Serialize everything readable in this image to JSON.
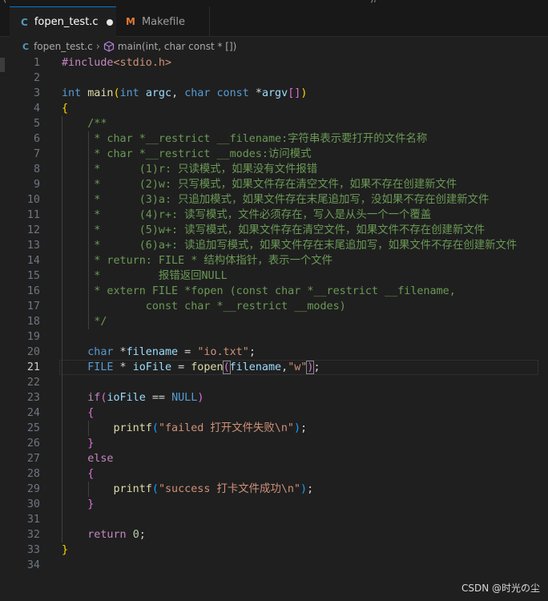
{
  "top_fragments": [
    "(",
    "), "
  ],
  "tabs": [
    {
      "icon": "C",
      "label": "fopen_test.c",
      "active": true,
      "modified": true
    },
    {
      "icon": "M",
      "label": "Makefile",
      "active": false
    }
  ],
  "breadcrumb": {
    "file_icon": "C",
    "file": "fopen_test.c",
    "symbol": "main(int, char const * [])"
  },
  "current_line": 21,
  "lines": [
    {
      "n": "1",
      "t": [
        [
          "pp",
          "#include"
        ],
        [
          "hdr",
          "<stdio.h>"
        ]
      ]
    },
    {
      "n": "2",
      "t": []
    },
    {
      "n": "3",
      "t": [
        [
          "kw",
          "int"
        ],
        [
          "op",
          " "
        ],
        [
          "fn",
          "main"
        ],
        [
          "br1",
          "("
        ],
        [
          "kw",
          "int"
        ],
        [
          "op",
          " "
        ],
        [
          "var",
          "argc"
        ],
        [
          "op",
          ", "
        ],
        [
          "kw",
          "char"
        ],
        [
          "op",
          " "
        ],
        [
          "kw",
          "const"
        ],
        [
          "op",
          " *"
        ],
        [
          "var",
          "argv"
        ],
        [
          "br2",
          "[]"
        ],
        [
          "br1",
          ")"
        ]
      ]
    },
    {
      "n": "4",
      "t": [
        [
          "br1",
          "{"
        ]
      ]
    },
    {
      "n": "5",
      "t": [
        [
          "cm",
          "    /**"
        ]
      ]
    },
    {
      "n": "6",
      "t": [
        [
          "cm",
          "     * char *__restrict __filename:字符串表示要打开的文件名称"
        ]
      ]
    },
    {
      "n": "7",
      "t": [
        [
          "cm",
          "     * char *__restrict __modes:访问模式"
        ]
      ]
    },
    {
      "n": "8",
      "t": [
        [
          "cm",
          "     *      (1)r: 只读模式，如果没有文件报错"
        ]
      ]
    },
    {
      "n": "9",
      "t": [
        [
          "cm",
          "     *      (2)w: 只写模式，如果文件存在清空文件，如果不存在创建新文件"
        ]
      ]
    },
    {
      "n": "10",
      "t": [
        [
          "cm",
          "     *      (3)a: 只追加模式，如果文件存在末尾追加写，没如果不存在创建新文件"
        ]
      ]
    },
    {
      "n": "11",
      "t": [
        [
          "cm",
          "     *      (4)r+: 读写模式，文件必须存在，写入是从头一个一个覆盖"
        ]
      ]
    },
    {
      "n": "12",
      "t": [
        [
          "cm",
          "     *      (5)w+: 读写模式，如果文件存在清空文件，如果文件不存在创建新文件"
        ]
      ]
    },
    {
      "n": "13",
      "t": [
        [
          "cm",
          "     *      (6)a+: 读追加写模式，如果文件存在末尾追加写，如果文件不存在创建新文件"
        ]
      ]
    },
    {
      "n": "14",
      "t": [
        [
          "cm",
          "     * return: FILE * 结构体指针，表示一个文件"
        ]
      ]
    },
    {
      "n": "15",
      "t": [
        [
          "cm",
          "     *         报错返回NULL"
        ]
      ]
    },
    {
      "n": "16",
      "t": [
        [
          "cm",
          "     * extern FILE *fopen (const char *__restrict __filename,"
        ]
      ]
    },
    {
      "n": "17",
      "t": [
        [
          "cm",
          "             const char *__restrict __modes)"
        ]
      ]
    },
    {
      "n": "18",
      "t": [
        [
          "cm",
          "     */"
        ]
      ]
    },
    {
      "n": "19",
      "t": []
    },
    {
      "n": "20",
      "t": [
        [
          "op",
          "    "
        ],
        [
          "kw",
          "char"
        ],
        [
          "op",
          " *"
        ],
        [
          "var",
          "filename"
        ],
        [
          "op",
          " = "
        ],
        [
          "str",
          "\"io.txt\""
        ],
        [
          "op",
          ";"
        ]
      ]
    },
    {
      "n": "21",
      "t": [
        [
          "op",
          "    "
        ],
        [
          "kw",
          "FILE"
        ],
        [
          "op",
          " * "
        ],
        [
          "var",
          "ioFile"
        ],
        [
          "op",
          " = "
        ],
        [
          "fn",
          "fopen"
        ],
        [
          "br2",
          "("
        ],
        [
          "var",
          "filename"
        ],
        [
          "op",
          ","
        ],
        [
          "str",
          "\"w\""
        ],
        [
          "br2",
          ")"
        ],
        [
          "op",
          ";"
        ]
      ]
    },
    {
      "n": "22",
      "t": []
    },
    {
      "n": "23",
      "t": [
        [
          "op",
          "    "
        ],
        [
          "ctl",
          "if"
        ],
        [
          "br2",
          "("
        ],
        [
          "var",
          "ioFile"
        ],
        [
          "op",
          " == "
        ],
        [
          "kw",
          "NULL"
        ],
        [
          "br2",
          ")"
        ]
      ]
    },
    {
      "n": "24",
      "t": [
        [
          "op",
          "    "
        ],
        [
          "br2",
          "{"
        ]
      ]
    },
    {
      "n": "25",
      "t": [
        [
          "op",
          "        "
        ],
        [
          "fn",
          "printf"
        ],
        [
          "br3",
          "("
        ],
        [
          "str",
          "\"failed 打开文件失败\\n\""
        ],
        [
          "br3",
          ")"
        ],
        [
          "op",
          ";"
        ]
      ]
    },
    {
      "n": "26",
      "t": [
        [
          "op",
          "    "
        ],
        [
          "br2",
          "}"
        ]
      ]
    },
    {
      "n": "27",
      "t": [
        [
          "op",
          "    "
        ],
        [
          "ctl",
          "else"
        ]
      ]
    },
    {
      "n": "28",
      "t": [
        [
          "op",
          "    "
        ],
        [
          "br2",
          "{"
        ]
      ]
    },
    {
      "n": "29",
      "t": [
        [
          "op",
          "        "
        ],
        [
          "fn",
          "printf"
        ],
        [
          "br3",
          "("
        ],
        [
          "str",
          "\"success 打卡文件成功\\n\""
        ],
        [
          "br3",
          ")"
        ],
        [
          "op",
          ";"
        ]
      ]
    },
    {
      "n": "30",
      "t": [
        [
          "op",
          "    "
        ],
        [
          "br2",
          "}"
        ]
      ]
    },
    {
      "n": "31",
      "t": []
    },
    {
      "n": "32",
      "t": [
        [
          "op",
          "    "
        ],
        [
          "ctl",
          "return"
        ],
        [
          "op",
          " "
        ],
        [
          "num",
          "0"
        ],
        [
          "op",
          ";"
        ]
      ]
    },
    {
      "n": "33",
      "t": [
        [
          "br1",
          "}"
        ]
      ]
    },
    {
      "n": "34",
      "t": []
    }
  ],
  "watermark": "CSDN @时光の尘"
}
